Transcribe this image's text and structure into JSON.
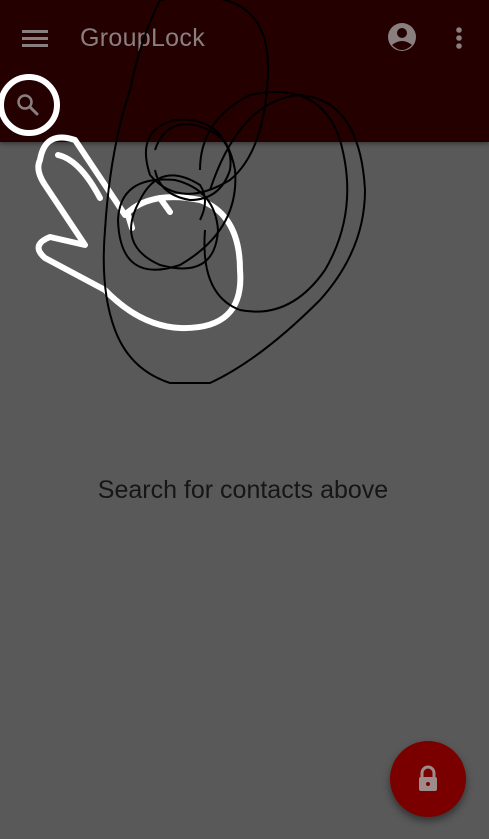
{
  "app_bar": {
    "title": "GroupLock",
    "background_color": "#250000",
    "icons": [
      "menu-icon",
      "account-circle-icon",
      "more-vert-icon",
      "search-icon"
    ]
  },
  "main": {
    "empty_message": "Search for contacts above",
    "background_color": "#595959"
  },
  "fab": {
    "icon": "lock-icon",
    "color": "#7a0000"
  },
  "overlay": {
    "gesture": "tap-hand-icon",
    "annotation": "scribble"
  }
}
